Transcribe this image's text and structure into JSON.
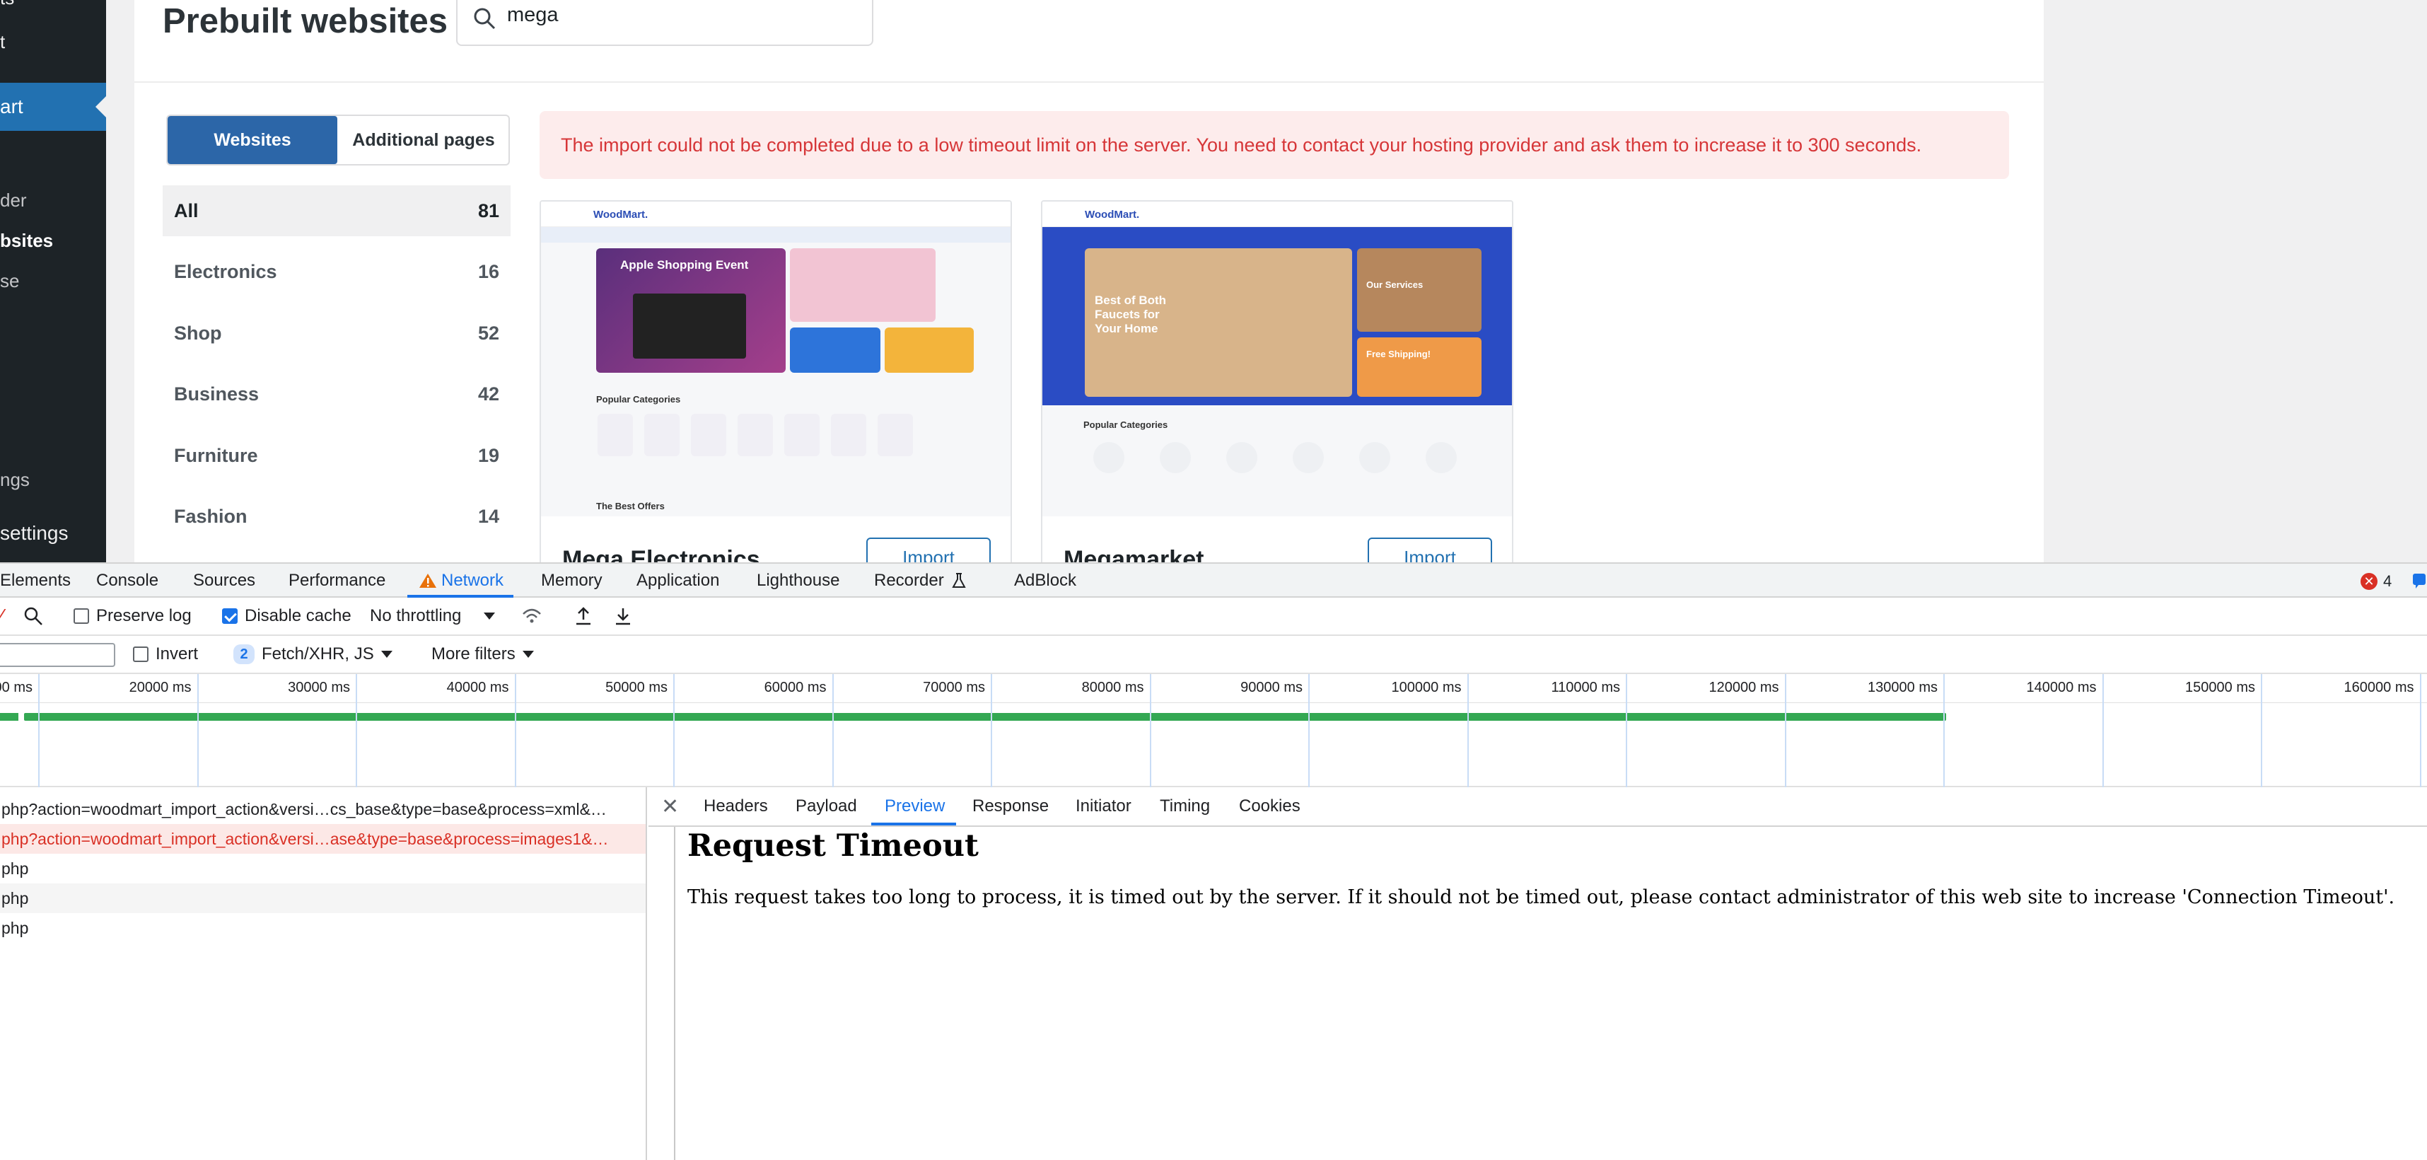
{
  "wp": {
    "sidebar": {
      "item_top": "ts",
      "item_t": "t",
      "item_active": "art",
      "sub_items": [
        "der",
        "bsites",
        "se"
      ],
      "item_ngs": "ngs",
      "item_settings": "settings"
    },
    "page_title": "Prebuilt websites",
    "search": {
      "value": "mega"
    },
    "tabs": {
      "websites": "Websites",
      "additional": "Additional pages"
    },
    "categories": [
      {
        "label": "All",
        "count": "81"
      },
      {
        "label": "Electronics",
        "count": "16"
      },
      {
        "label": "Shop",
        "count": "52"
      },
      {
        "label": "Business",
        "count": "42"
      },
      {
        "label": "Furniture",
        "count": "19"
      },
      {
        "label": "Fashion",
        "count": "14"
      }
    ],
    "error_message": "The import could not be completed due to a low timeout limit on the server. You need to contact your hosting provider and ask them to increase it to 300 seconds.",
    "cards": [
      {
        "title": "Mega Electronics",
        "import_label": "Import",
        "thumb": {
          "logo": "WoodMart.",
          "hero_title": "Apple Shopping Event",
          "section": "Popular Categories",
          "footer": "The Best Offers"
        }
      },
      {
        "title": "Megamarket",
        "import_label": "Import",
        "thumb": {
          "logo": "WoodMart.",
          "hero_title": "Best of Both Faucets for Your Home",
          "side_1": "Our Services",
          "side_2": "Free Shipping!",
          "section": "Popular Categories"
        }
      }
    ]
  },
  "devtools": {
    "tabs": [
      "Elements",
      "Console",
      "Sources",
      "Performance",
      "Network",
      "Memory",
      "Application",
      "Lighthouse",
      "Recorder",
      "AdBlock"
    ],
    "error_count": "4",
    "toolbar": {
      "preserve_log": "Preserve log",
      "disable_cache": "Disable cache",
      "throttling": "No throttling"
    },
    "filterbar": {
      "invert": "Invert",
      "type_count": "2",
      "type_filter": "Fetch/XHR, JS",
      "more_filters": "More filters"
    },
    "timeline_labels": [
      "00 ms",
      "20000 ms",
      "30000 ms",
      "40000 ms",
      "50000 ms",
      "60000 ms",
      "70000 ms",
      "80000 ms",
      "90000 ms",
      "100000 ms",
      "110000 ms",
      "120000 ms",
      "130000 ms",
      "140000 ms",
      "150000 ms",
      "160000 ms"
    ],
    "requests": [
      "php?action=woodmart_import_action&versi…cs_base&type=base&process=xml&…",
      "php?action=woodmart_import_action&versi…ase&type=base&process=images1&…",
      "php",
      "php",
      "php"
    ],
    "detail_tabs": [
      "Headers",
      "Payload",
      "Preview",
      "Response",
      "Initiator",
      "Timing",
      "Cookies"
    ],
    "preview": {
      "title": "Request Timeout",
      "body": "This request takes too long to process, it is timed out by the server. If it should not be timed out, please contact administrator of this web site to increase 'Connection Timeout'."
    }
  }
}
